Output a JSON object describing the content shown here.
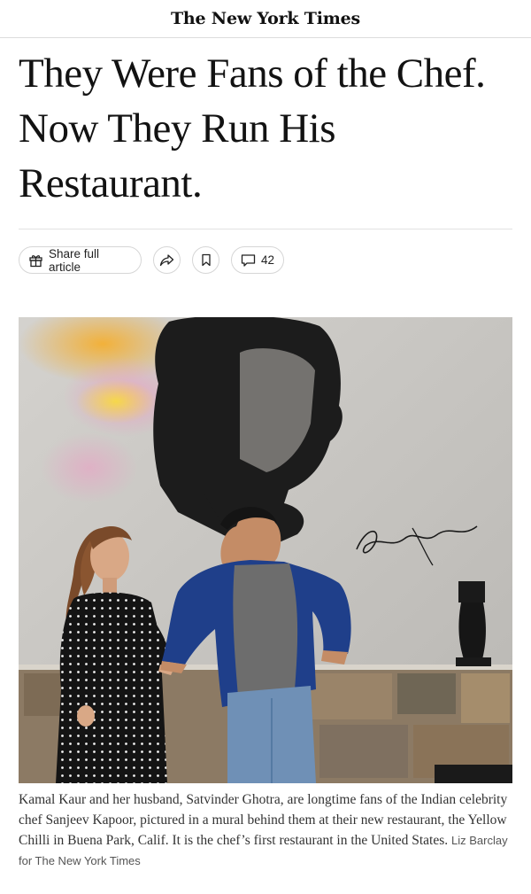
{
  "masthead": {
    "logo": "The New York Times"
  },
  "article": {
    "headline": "They Were Fans of the Chef. Now They Run His Restaurant."
  },
  "toolbar": {
    "share_label": "Share full article",
    "comments_count": "42",
    "icons": {
      "share": "gift-icon",
      "forward": "forward-arrow-icon",
      "save": "bookmark-icon",
      "comments": "comment-bubble-icon"
    }
  },
  "photo": {
    "signature": "Sanjeev Kapoor",
    "caption": "Kamal Kaur and her husband, Satvinder Ghotra, are longtime fans of the Indian celebrity chef Sanjeev Kapoor, pictured in a mural behind them at their new restaurant, the Yellow Chilli in Buena Park, Calif. It is the chef’s first restaurant in the United States.",
    "credit": "Liz Barclay for The New York Times"
  },
  "colors": {
    "text": "#121212",
    "border": "#d6d6d6",
    "jacket": "#1f3f8a",
    "wall": "#c9c7c3"
  }
}
